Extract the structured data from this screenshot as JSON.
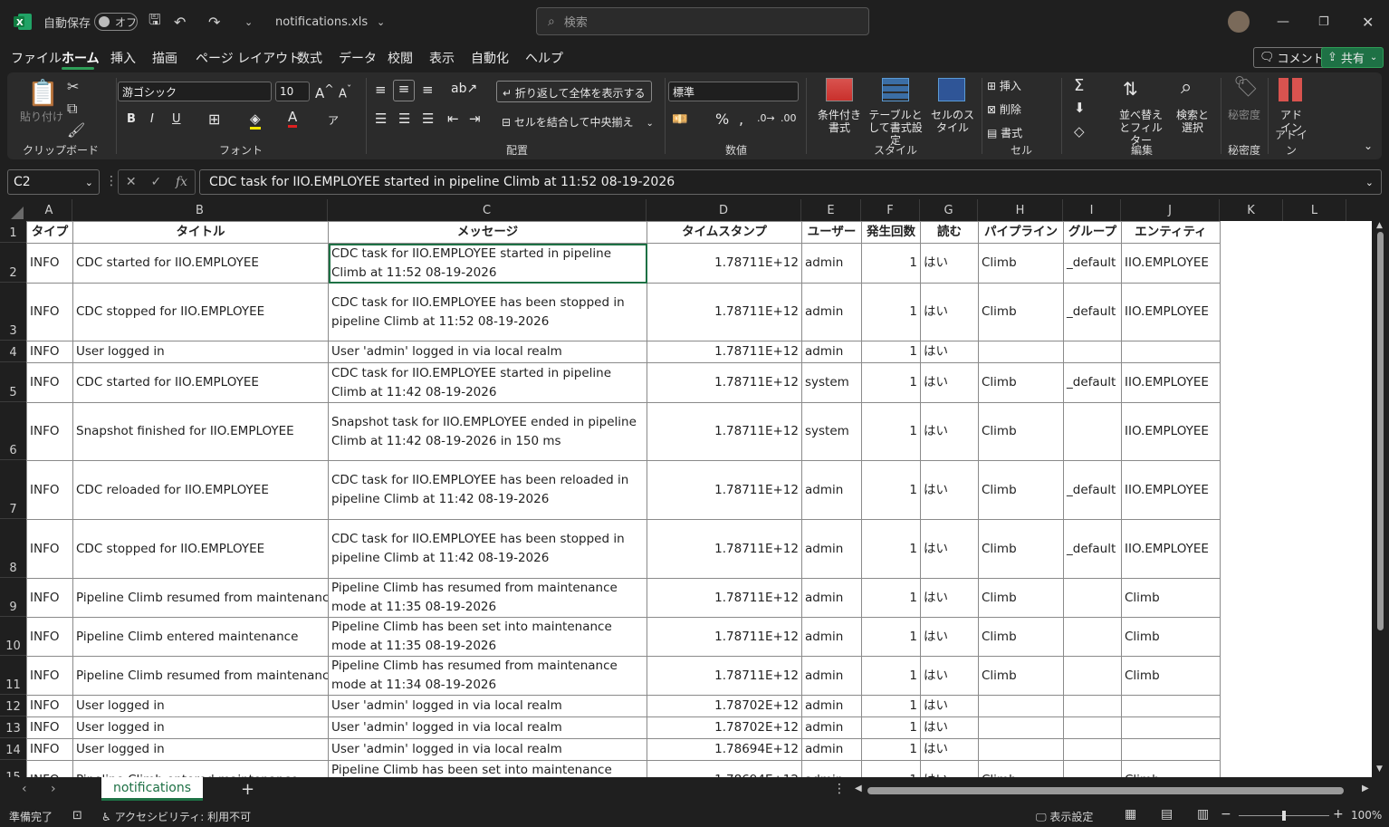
{
  "titlebar": {
    "autosave_label": "自動保存",
    "autosave_state": "オフ",
    "filename": "notifications.xls",
    "search_placeholder": "検索"
  },
  "menu": [
    "ファイル",
    "ホーム",
    "挿入",
    "描画",
    "ページ レイアウト",
    "数式",
    "データ",
    "校閲",
    "表示",
    "自動化",
    "ヘルプ"
  ],
  "menu_active": "ホーム",
  "comment_button": "コメント",
  "share_button": "共有",
  "ribbon": {
    "clipboard": {
      "paste": "貼り付け",
      "label": "クリップボード"
    },
    "font": {
      "name": "游ゴシック",
      "size": "10",
      "label": "フォント"
    },
    "alignment": {
      "wrap": "折り返して全体を表示する",
      "merge": "セルを結合して中央揃え",
      "label": "配置"
    },
    "number": {
      "format": "標準",
      "label": "数値"
    },
    "styles": {
      "conditional": "条件付き書式",
      "table": "テーブルとして書式設定",
      "cell": "セルのスタイル",
      "label": "スタイル"
    },
    "cells": {
      "insert": "挿入",
      "delete": "削除",
      "format": "書式",
      "label": "セル"
    },
    "editing": {
      "sort": "並べ替えとフィルター",
      "find": "検索と選択",
      "label": "編集"
    },
    "sensitivity": {
      "btn": "秘密度",
      "label": "秘密度"
    },
    "addins": {
      "btn": "アドイン",
      "label": "アドイン"
    }
  },
  "namebox": "C2",
  "formula": "CDC task for IIO.EMPLOYEE started in pipeline Climb at 11:52 08-19-2026",
  "columns": [
    "A",
    "B",
    "C",
    "D",
    "E",
    "F",
    "G",
    "H",
    "I",
    "J",
    "K",
    "L"
  ],
  "headers": [
    "タイプ",
    "タイトル",
    "メッセージ",
    "タイムスタンプ",
    "ユーザー",
    "発生回数",
    "読む",
    "パイプライン",
    "グループ",
    "エンティティ"
  ],
  "rows": [
    [
      "INFO",
      "CDC started for IIO.EMPLOYEE",
      "CDC task for IIO.EMPLOYEE started in pipeline Climb at 11:52 08-19-2026",
      "1.78711E+12",
      "admin",
      "1",
      "はい",
      "Climb",
      "_default",
      "IIO.EMPLOYEE"
    ],
    [
      "INFO",
      "CDC stopped for IIO.EMPLOYEE",
      "CDC task for IIO.EMPLOYEE has been stopped in pipeline Climb at 11:52 08-19-2026",
      "1.78711E+12",
      "admin",
      "1",
      "はい",
      "Climb",
      "_default",
      "IIO.EMPLOYEE"
    ],
    [
      "INFO",
      "User logged in",
      "User 'admin' logged in via local realm",
      "1.78711E+12",
      "admin",
      "1",
      "はい",
      "",
      "",
      ""
    ],
    [
      "INFO",
      "CDC started for IIO.EMPLOYEE",
      "CDC task for IIO.EMPLOYEE started in pipeline Climb at 11:42 08-19-2026",
      "1.78711E+12",
      "system",
      "1",
      "はい",
      "Climb",
      "_default",
      "IIO.EMPLOYEE"
    ],
    [
      "INFO",
      "Snapshot finished for IIO.EMPLOYEE",
      "Snapshot task for IIO.EMPLOYEE ended in pipeline Climb at 11:42 08-19-2026 in 150 ms",
      "1.78711E+12",
      "system",
      "1",
      "はい",
      "Climb",
      "",
      "IIO.EMPLOYEE"
    ],
    [
      "INFO",
      "CDC reloaded for IIO.EMPLOYEE",
      "CDC task for IIO.EMPLOYEE has been reloaded in pipeline Climb at 11:42 08-19-2026",
      "1.78711E+12",
      "admin",
      "1",
      "はい",
      "Climb",
      "_default",
      "IIO.EMPLOYEE"
    ],
    [
      "INFO",
      "CDC stopped for IIO.EMPLOYEE",
      "CDC task for IIO.EMPLOYEE has been stopped in pipeline Climb at 11:42 08-19-2026",
      "1.78711E+12",
      "admin",
      "1",
      "はい",
      "Climb",
      "_default",
      "IIO.EMPLOYEE"
    ],
    [
      "INFO",
      "Pipeline Climb resumed from maintenance",
      "Pipeline Climb has resumed from maintenance mode at 11:35 08-19-2026",
      "1.78711E+12",
      "admin",
      "1",
      "はい",
      "Climb",
      "",
      "Climb"
    ],
    [
      "INFO",
      "Pipeline Climb entered maintenance",
      "Pipeline Climb has been set into maintenance mode at 11:35 08-19-2026",
      "1.78711E+12",
      "admin",
      "1",
      "はい",
      "Climb",
      "",
      "Climb"
    ],
    [
      "INFO",
      "Pipeline Climb resumed from maintenance",
      "Pipeline Climb has resumed from maintenance mode at 11:34 08-19-2026",
      "1.78711E+12",
      "admin",
      "1",
      "はい",
      "Climb",
      "",
      "Climb"
    ],
    [
      "INFO",
      "User logged in",
      "User 'admin' logged in via local realm",
      "1.78702E+12",
      "admin",
      "1",
      "はい",
      "",
      "",
      ""
    ],
    [
      "INFO",
      "User logged in",
      "User 'admin' logged in via local realm",
      "1.78702E+12",
      "admin",
      "1",
      "はい",
      "",
      "",
      ""
    ],
    [
      "INFO",
      "User logged in",
      "User 'admin' logged in via local realm",
      "1.78694E+12",
      "admin",
      "1",
      "はい",
      "",
      "",
      ""
    ],
    [
      "INFO",
      "Pipeline Climb entered maintenance",
      "Pipeline Climb has been set into maintenance mode at",
      "1.78694E+12",
      "admin",
      "1",
      "はい",
      "Climb",
      "",
      "Climb"
    ]
  ],
  "sheet_tab": "notifications",
  "status": {
    "ready": "準備完了",
    "accessibility": "アクセシビリティ: 利用不可",
    "display_settings": "表示設定",
    "zoom": "100%"
  }
}
